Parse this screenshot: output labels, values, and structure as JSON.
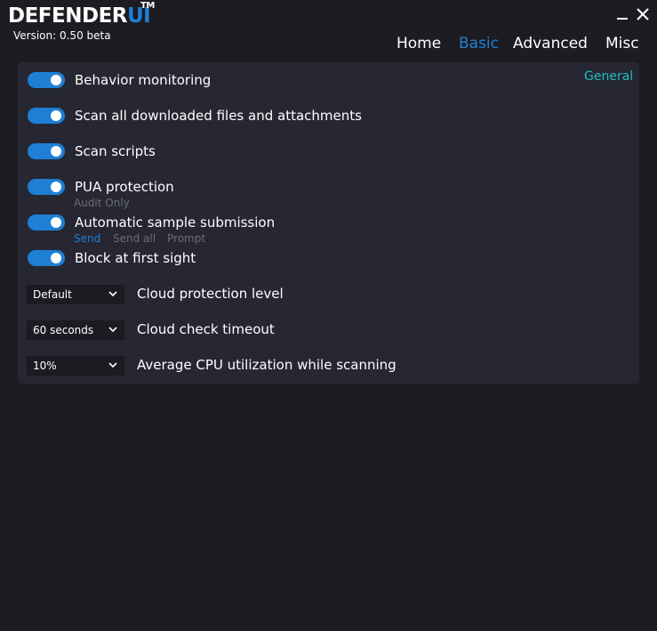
{
  "app": {
    "logo_main": "DEFENDER",
    "logo_accent": "UI",
    "logo_tm": "TM",
    "version": "Version: 0.50 beta",
    "minimize": "_",
    "close": "✕"
  },
  "nav": {
    "tabs": [
      {
        "label": "Home",
        "active": false
      },
      {
        "label": "Basic",
        "active": true
      },
      {
        "label": "Advanced",
        "active": false
      },
      {
        "label": "Misc",
        "active": false
      }
    ]
  },
  "section": {
    "label": "General"
  },
  "toggles": [
    {
      "label": "Behavior monitoring",
      "on": true
    },
    {
      "label": "Scan all downloaded files and attachments",
      "on": true
    },
    {
      "label": "Scan scripts",
      "on": true
    },
    {
      "label": "PUA protection",
      "on": true,
      "sub": "Audit Only"
    },
    {
      "label": "Automatic sample submission",
      "on": true,
      "options": [
        "Send",
        "Send all",
        "Prompt"
      ],
      "selected": "Send"
    },
    {
      "label": "Block at first sight",
      "on": true
    }
  ],
  "selects": [
    {
      "value": "Default",
      "label": "Cloud protection level"
    },
    {
      "value": "60 seconds",
      "label": "Cloud check timeout"
    },
    {
      "value": "10%",
      "label": "Average CPU utilization while scanning"
    }
  ],
  "colors": {
    "accent": "#1e80d6",
    "section": "#1fbfbf",
    "panel": "#262733",
    "background": "#1c1c22"
  }
}
